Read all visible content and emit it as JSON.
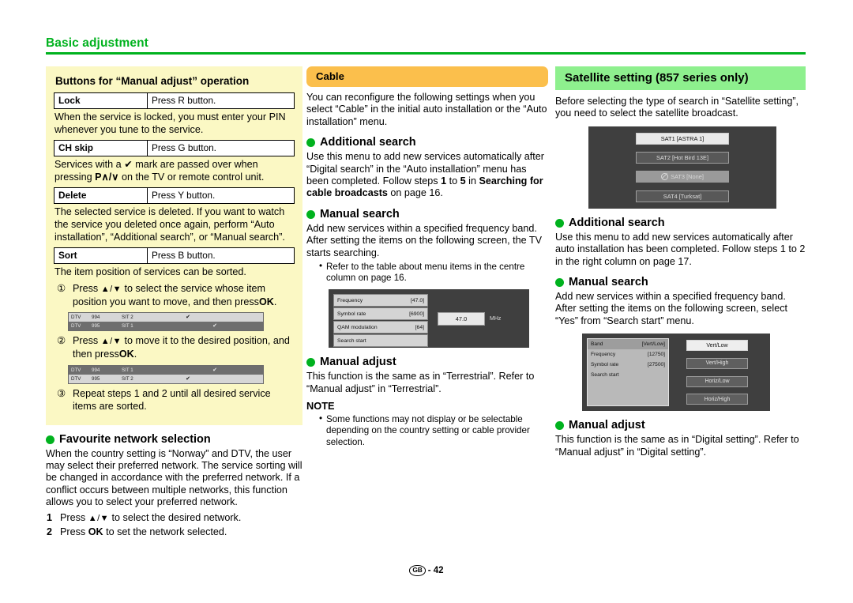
{
  "running_head": {
    "title": "Basic adjustment"
  },
  "left_column": {
    "tipbox": {
      "title": "Buttons for “Manual adjust” operation",
      "rows": [
        {
          "key": "Lock",
          "value": "Press R button."
        },
        {
          "key": "CH skip",
          "value": "Press G button."
        },
        {
          "key": "Delete",
          "value": "Press Y button."
        },
        {
          "key": "Sort",
          "value": "Press B button."
        }
      ],
      "lock_desc": "When the service is locked, you must enter your PIN whenever you tune to the service.",
      "chskip_desc_a": "Services with a",
      "chskip_check": "✔",
      "chskip_desc_b": "mark are passed over when pressing",
      "chskip_keys": "P∧/∨",
      "chskip_desc_c": "on the TV or remote control unit.",
      "delete_desc": "The selected service is deleted. If you want to watch the service you deleted once again, perform “Auto installation”, “Additional search”, or “Manual search”.",
      "sort_desc": "The item position of services can be sorted.",
      "step1_num": "①",
      "step1_a": "Press",
      "step1_keys": "▲/▼",
      "step1_b": "to select the service whose item position you want to move, and then press",
      "step1_ok": "OK",
      "step1_end": ".",
      "screen1": {
        "rows": [
          {
            "c1": "DTV",
            "c2": "994",
            "c3": "SIT 2",
            "check": "✔",
            "style": "light",
            "check_col": 3
          },
          {
            "c1": "DTV",
            "c2": "995",
            "c3": "SIT 1",
            "check": "✔",
            "style": "dark",
            "check_col": 4
          }
        ]
      },
      "step2_num": "②",
      "step2_a": "Press",
      "step2_keys": "▲/▼",
      "step2_b": "to move it to the desired position, and then press",
      "step2_ok": "OK",
      "step2_end": ".",
      "screen2": {
        "rows": [
          {
            "c1": "DTV",
            "c2": "994",
            "c3": "SIT 1",
            "check": "✔",
            "style": "dark",
            "check_col": 4
          },
          {
            "c1": "DTV",
            "c2": "995",
            "c3": "SIT 2",
            "check": "✔",
            "style": "light",
            "check_col": 3
          }
        ]
      },
      "step3_num": "③",
      "step3_text": "Repeat steps 1 and 2 until all desired service items are sorted."
    },
    "favourite": {
      "heading": "Favourite network selection",
      "body": "When the country setting is “Norway” and DTV, the user may select their preferred network. The service sorting will be changed in accordance with the preferred network. If a conflict occurs between multiple networks, this function allows you to select your preferred network.",
      "steps": [
        {
          "n": "1",
          "a": "Press",
          "keys": "▲/▼",
          "b": "to select the desired network.",
          "bold": "",
          "tail": ""
        },
        {
          "n": "2",
          "a": "Press",
          "keys": "",
          "b": "to set the network selected.",
          "bold": "OK",
          "tail": ""
        }
      ]
    }
  },
  "mid_column": {
    "banner": "Cable",
    "intro": "You can reconfigure the following settings when you select “Cable” in the initial auto installation or the “Auto installation” menu.",
    "additional_search": {
      "heading": "Additional search",
      "body_a": "Use this menu to add new services automatically after “Digital search” in the “Auto installation” menu has been completed. Follow steps",
      "step_from": "1",
      "body_to": "to",
      "step_to": "5",
      "body_in": "in",
      "bold_ref": "Searching for cable broadcasts",
      "body_end": "on page 16."
    },
    "manual_search": {
      "heading": "Manual search",
      "body": "Add new services within a specified frequency band. After setting the items on the following screen, the TV starts searching.",
      "note": "Refer to the table about menu items in the centre column on page 16.",
      "screen": {
        "rows": [
          {
            "label": "Frequency",
            "value": "[47.0]"
          },
          {
            "label": "Symbol rate",
            "value": "[6900]"
          },
          {
            "label": "QAM modulation",
            "value": "[64]"
          },
          {
            "label": "Search start",
            "value": ""
          }
        ],
        "value_box": "47.0",
        "unit": "MHz"
      }
    },
    "manual_adjust": {
      "heading": "Manual adjust",
      "body": "This function is the same as in “Terrestrial”. Refer to “Manual adjust” in “Terrestrial”."
    },
    "note": {
      "title": "NOTE",
      "items": [
        "Some functions may not display or be selectable depending on the country setting or cable provider selection."
      ]
    }
  },
  "right_column": {
    "banner": "Satellite setting (857 series only)",
    "intro": "Before selecting the type of search in “Satellite setting”, you need to select the satellite broadcast.",
    "sat_screen": {
      "buttons": [
        {
          "label": "SAT1 [ASTRA 1]",
          "state": "selected",
          "icon": ""
        },
        {
          "label": "SAT2 [Hot Bird 13E]",
          "state": "normal",
          "icon": ""
        },
        {
          "label": "SAT3 [None]",
          "state": "disabled",
          "icon": "no-entry-icon"
        },
        {
          "label": "SAT4 [Turksat]",
          "state": "normal",
          "icon": ""
        }
      ]
    },
    "additional_search": {
      "heading": "Additional search",
      "body": "Use this menu to add new services automatically after auto installation has been completed. Follow steps 1 to 2 in the right column on page 17."
    },
    "manual_search": {
      "heading": "Manual search",
      "body": "Add new services within a specified frequency band. After setting the items on the following screen, select “Yes” from “Search start” menu.",
      "screen": {
        "rows": [
          {
            "label": "Band",
            "value": "[Vert/Low]",
            "highlight": true
          },
          {
            "label": "Frequency",
            "value": "[12750]",
            "highlight": false
          },
          {
            "label": "Symbol rate",
            "value": "[27500]",
            "highlight": false
          },
          {
            "label": "Search start",
            "value": "",
            "highlight": false
          }
        ],
        "band_options": [
          {
            "label": "Vert/Low",
            "selected": true
          },
          {
            "label": "Vert/High",
            "selected": false
          },
          {
            "label": "Horiz/Low",
            "selected": false
          },
          {
            "label": "Horiz/High",
            "selected": false
          }
        ]
      }
    },
    "manual_adjust": {
      "heading": "Manual adjust",
      "body": "This function is the same as in “Digital setting”. Refer to “Manual adjust” in “Digital setting”."
    }
  },
  "footer": {
    "region": "GB",
    "page": "- 42"
  },
  "colors": {
    "accent_green": "#00b21e",
    "banner_orange": "#fbbf4c",
    "banner_green": "#8ef08e",
    "tipbox_yellow": "#fbf8c4"
  }
}
